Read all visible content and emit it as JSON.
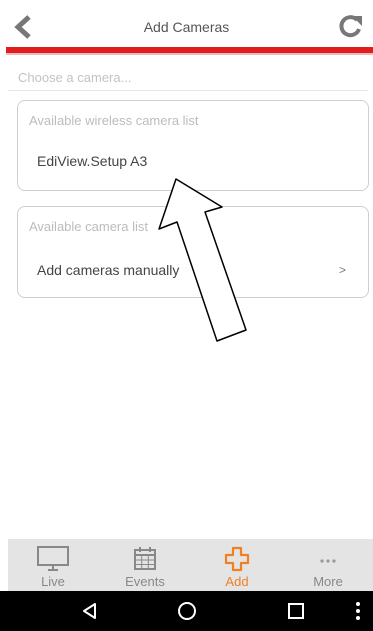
{
  "header": {
    "title": "Add Cameras"
  },
  "content": {
    "choose_label": "Choose a camera...",
    "wireless": {
      "title": "Available wireless camera list",
      "item": "EdiView.Setup A3"
    },
    "camera_list": {
      "title": "Available camera list",
      "item": "Add cameras manually",
      "chevron": ">"
    }
  },
  "tabs": [
    {
      "label": "Live",
      "icon": "monitor-icon"
    },
    {
      "label": "Events",
      "icon": "calendar-icon"
    },
    {
      "label": "Add",
      "icon": "plus-icon"
    },
    {
      "label": "More",
      "icon": "more-icon"
    }
  ],
  "colors": {
    "accent_red": "#e01e1e",
    "active_orange": "#f08023",
    "tabbar_bg": "#e4e4e4"
  }
}
